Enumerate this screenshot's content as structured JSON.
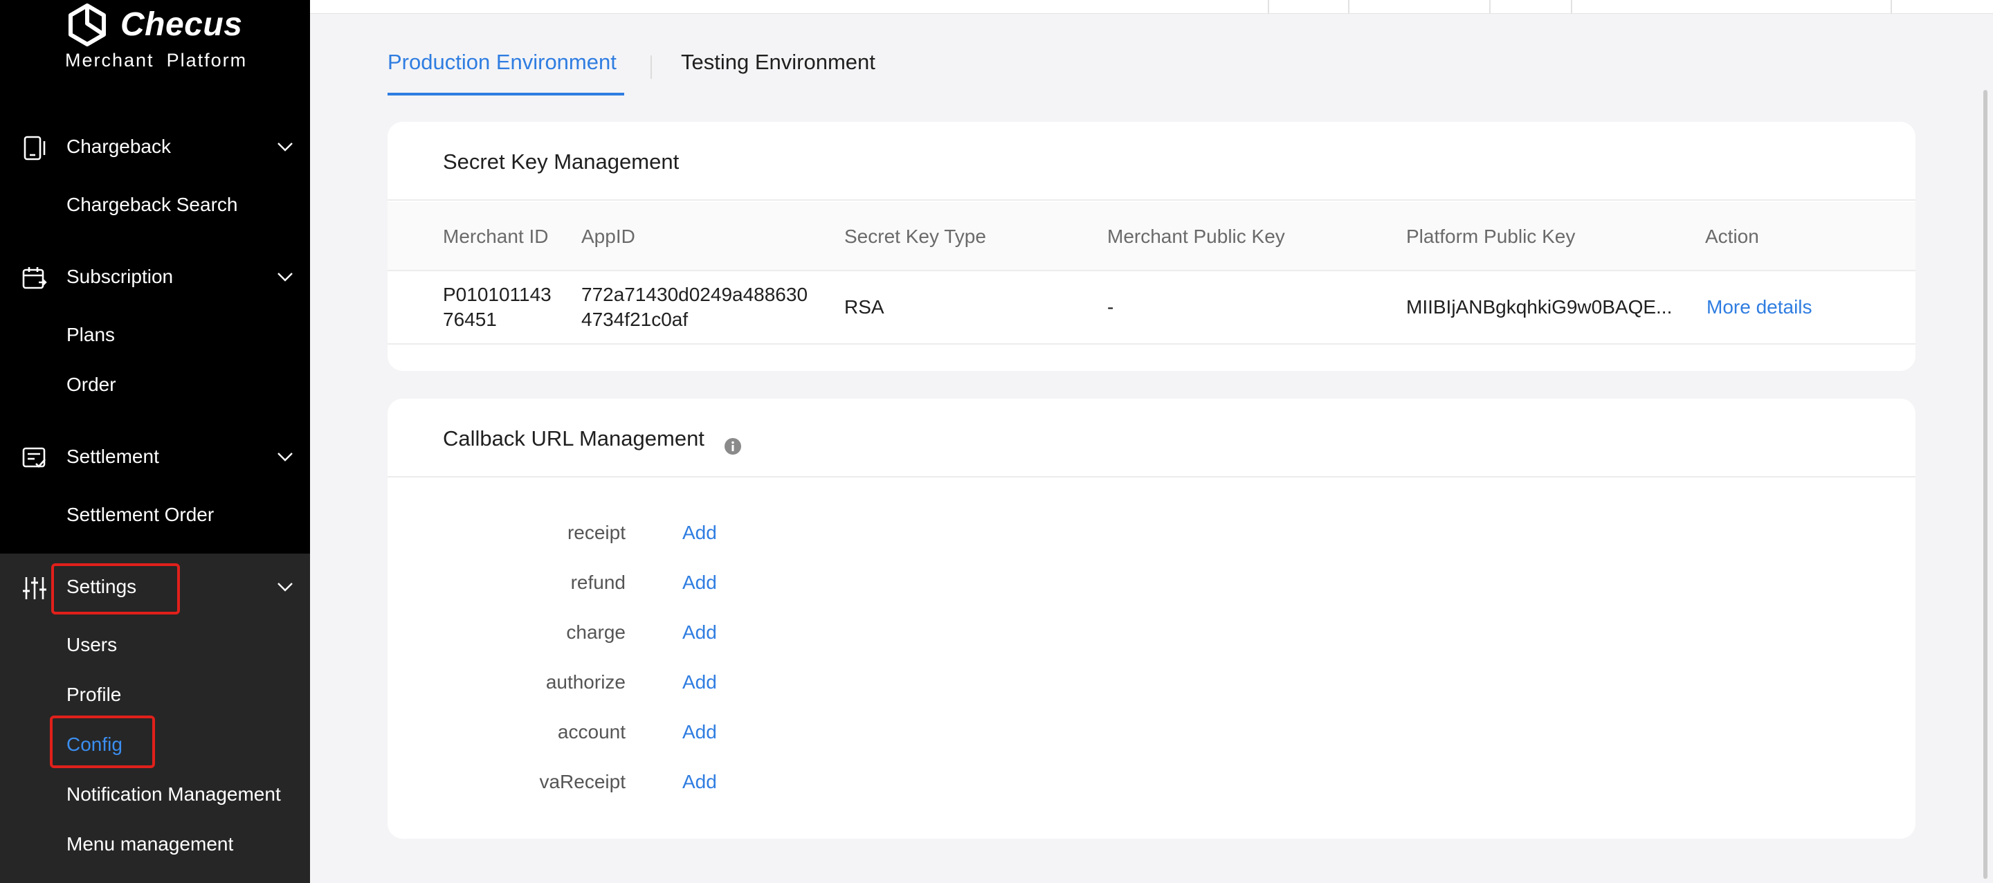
{
  "brand": {
    "name": "Checus",
    "subtitle_1": "Merchant",
    "subtitle_2": "Platform"
  },
  "sidebar": {
    "groups": [
      {
        "label": "Chargeback",
        "icon": "phone-card-icon",
        "items": [
          "Chargeback Search"
        ]
      },
      {
        "label": "Subscription",
        "icon": "calendar-sync-icon",
        "items": [
          "Plans",
          "Order"
        ]
      },
      {
        "label": "Settlement",
        "icon": "checklist-icon",
        "items": [
          "Settlement Order"
        ]
      },
      {
        "label": "Settings",
        "icon": "sliders-icon",
        "items": [
          "Users",
          "Profile",
          "Config",
          "Notification Management",
          "Menu management"
        ]
      }
    ],
    "active_item": "Config"
  },
  "tabs": [
    {
      "label": "Production Environment",
      "active": true
    },
    {
      "label": "Testing Environment",
      "active": false
    }
  ],
  "secret_key": {
    "title": "Secret Key Management",
    "columns": [
      "Merchant ID",
      "AppID",
      "Secret Key Type",
      "Merchant Public Key",
      "Platform Public Key",
      "Action"
    ],
    "row": {
      "merchant_id_1": "P010101143",
      "merchant_id_2": "76451",
      "app_id_1": "772a71430d0249a488630",
      "app_id_2": "4734f21c0af",
      "key_type": "RSA",
      "merchant_public_key": "-",
      "platform_public_key": "MIIBIjANBgkqhkiG9w0BAQE...",
      "action": "More details"
    }
  },
  "callback": {
    "title": "Callback URL Management",
    "add_label": "Add",
    "rows": [
      "receipt",
      "refund",
      "charge",
      "authorize",
      "account",
      "vaReceipt"
    ]
  },
  "colors": {
    "accent": "#2f7de1",
    "highlight": "#e0201b",
    "sidebar_bg": "#000000",
    "sidebar_sub_bg": "#262626"
  }
}
